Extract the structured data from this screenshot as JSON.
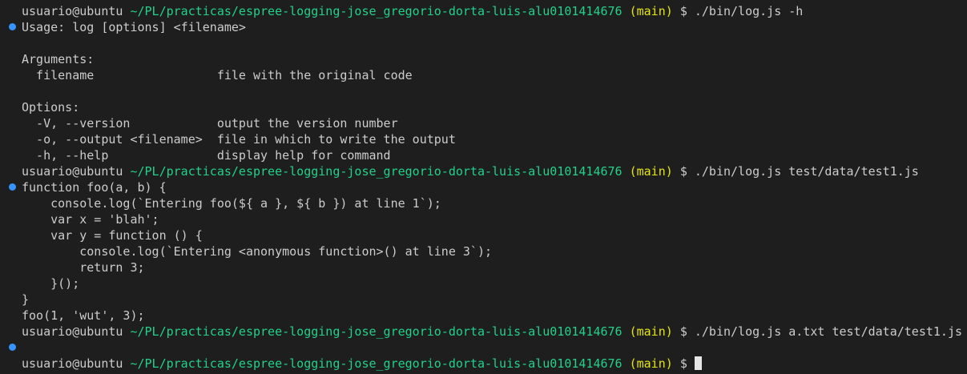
{
  "terminal": {
    "colors": {
      "background": "#1e1e1e",
      "text": "#cccccc",
      "path": "#23d18b",
      "branch": "#e5e510",
      "decoration_success": "#3794ff",
      "decoration_pending": "#8a8a8a"
    },
    "prompt": {
      "user_host": "usuario@ubuntu",
      "path": "~/PL/practicas/espree-logging-jose_gregorio-dorta-luis-alu0101414676",
      "branch": "(main)",
      "symbol": "$"
    },
    "commands": [
      "./bin/log.js -h",
      "./bin/log.js test/data/test1.js",
      "./bin/log.js a.txt test/data/test1.js",
      ""
    ],
    "help_output": [
      "Usage: log [options] <filename>",
      "",
      "Arguments:",
      "  filename                 file with the original code",
      "",
      "Options:",
      "  -V, --version            output the version number",
      "  -o, --output <filename>  file in which to write the output",
      "  -h, --help               display help for command"
    ],
    "code_output": [
      "function foo(a, b) {",
      "    console.log(`Entering foo(${ a }, ${ b }) at line 1`);",
      "    var x = 'blah';",
      "    var y = function () {",
      "        console.log(`Entering <anonymous function>() at line 3`);",
      "        return 3;",
      "    }();",
      "}",
      "foo(1, 'wut', 3);"
    ]
  }
}
